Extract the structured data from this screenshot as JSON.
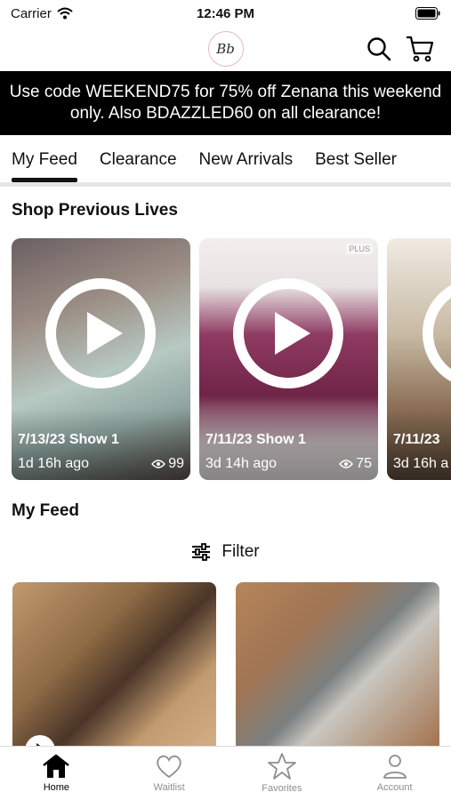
{
  "status_bar": {
    "carrier": "Carrier",
    "time": "12:46 PM"
  },
  "header": {
    "logo_text": "Bb"
  },
  "promo": {
    "text": "Use code WEEKEND75 for 75% off Zenana this weekend only. Also BDAZZLED60 on all clearance!"
  },
  "tabs": [
    {
      "label": "My Feed",
      "active": true
    },
    {
      "label": "Clearance"
    },
    {
      "label": "New Arrivals"
    },
    {
      "label": "Best Seller"
    }
  ],
  "lives": {
    "title": "Shop Previous Lives",
    "items": [
      {
        "title": "7/13/23 Show 1",
        "ago": "1d 16h ago",
        "views": "99"
      },
      {
        "title": "7/11/23 Show 1",
        "ago": "3d 14h ago",
        "views": "75",
        "badge": "PLUS"
      },
      {
        "title": "7/11/23",
        "ago": "3d 16h a"
      }
    ]
  },
  "feed": {
    "title": "My Feed",
    "filter_label": "Filter"
  },
  "tab_bar": [
    {
      "label": "Home",
      "icon": "home-icon",
      "active": true
    },
    {
      "label": "Waitlist",
      "icon": "heart-icon"
    },
    {
      "label": "Favorites",
      "icon": "star-icon"
    },
    {
      "label": "Account",
      "icon": "account-icon"
    }
  ]
}
